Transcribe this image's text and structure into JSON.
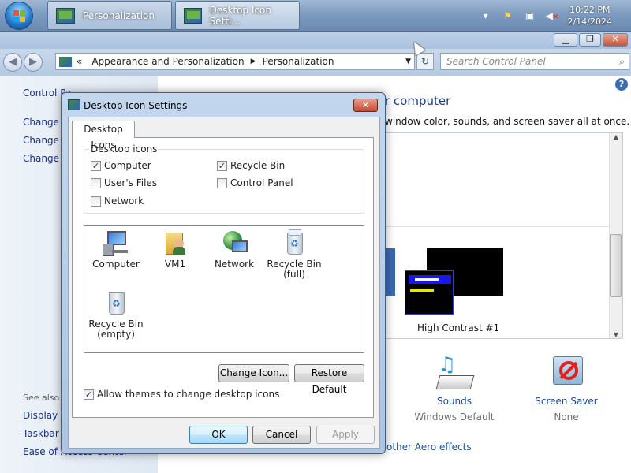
{
  "taskbar": {
    "buttons": [
      {
        "label": "Personalization"
      },
      {
        "label": "Desktop Icon Setti..."
      }
    ],
    "clock": {
      "time": "10:22 PM",
      "date": "2/14/2024"
    }
  },
  "control_panel": {
    "breadcrumb": {
      "root": "«",
      "parent": "Appearance and Personalization",
      "current": "Personalization"
    },
    "search_placeholder": "Search Control Panel",
    "sidebar": {
      "home_link": "Control Pa...",
      "links": [
        "Change d",
        "Change m",
        "Change y"
      ],
      "see_also_label": "See also",
      "see_also": [
        "Display",
        "Taskbar a",
        "Ease of Access Center"
      ]
    },
    "main": {
      "title": "r computer",
      "subtitle": "window color, sounds, and screen saver all at once.",
      "selected_theme": "High Contrast #1",
      "bottom": [
        {
          "link": "Sounds",
          "value": "Windows Default",
          "icon": "sounds-icon"
        },
        {
          "link": "Screen Saver",
          "value": "None",
          "icon": "screen-saver-icon"
        }
      ],
      "aero_link": "other Aero effects"
    }
  },
  "dialog": {
    "title": "Desktop Icon Settings",
    "tab": "Desktop Icons",
    "group_label": "Desktop icons",
    "checkboxes": [
      {
        "label": "Computer",
        "checked": true
      },
      {
        "label": "Recycle Bin",
        "checked": true
      },
      {
        "label": "User's Files",
        "checked": false
      },
      {
        "label": "Control Panel",
        "checked": false
      },
      {
        "label": "Network",
        "checked": false
      }
    ],
    "icons": [
      {
        "label": "Computer",
        "icon": "computer-icon"
      },
      {
        "label": "VM1",
        "icon": "user-folder-icon"
      },
      {
        "label": "Network",
        "icon": "network-icon"
      },
      {
        "label": "Recycle Bin (full)",
        "icon": "recycle-bin-full-icon"
      },
      {
        "label": "Recycle Bin (empty)",
        "icon": "recycle-bin-empty-icon"
      }
    ],
    "change_icon_label": "Change Icon...",
    "restore_default_label": "Restore Default",
    "allow_themes": {
      "label": "Allow themes to change desktop icons",
      "checked": true
    },
    "ok_label": "OK",
    "cancel_label": "Cancel",
    "apply_label": "Apply"
  }
}
